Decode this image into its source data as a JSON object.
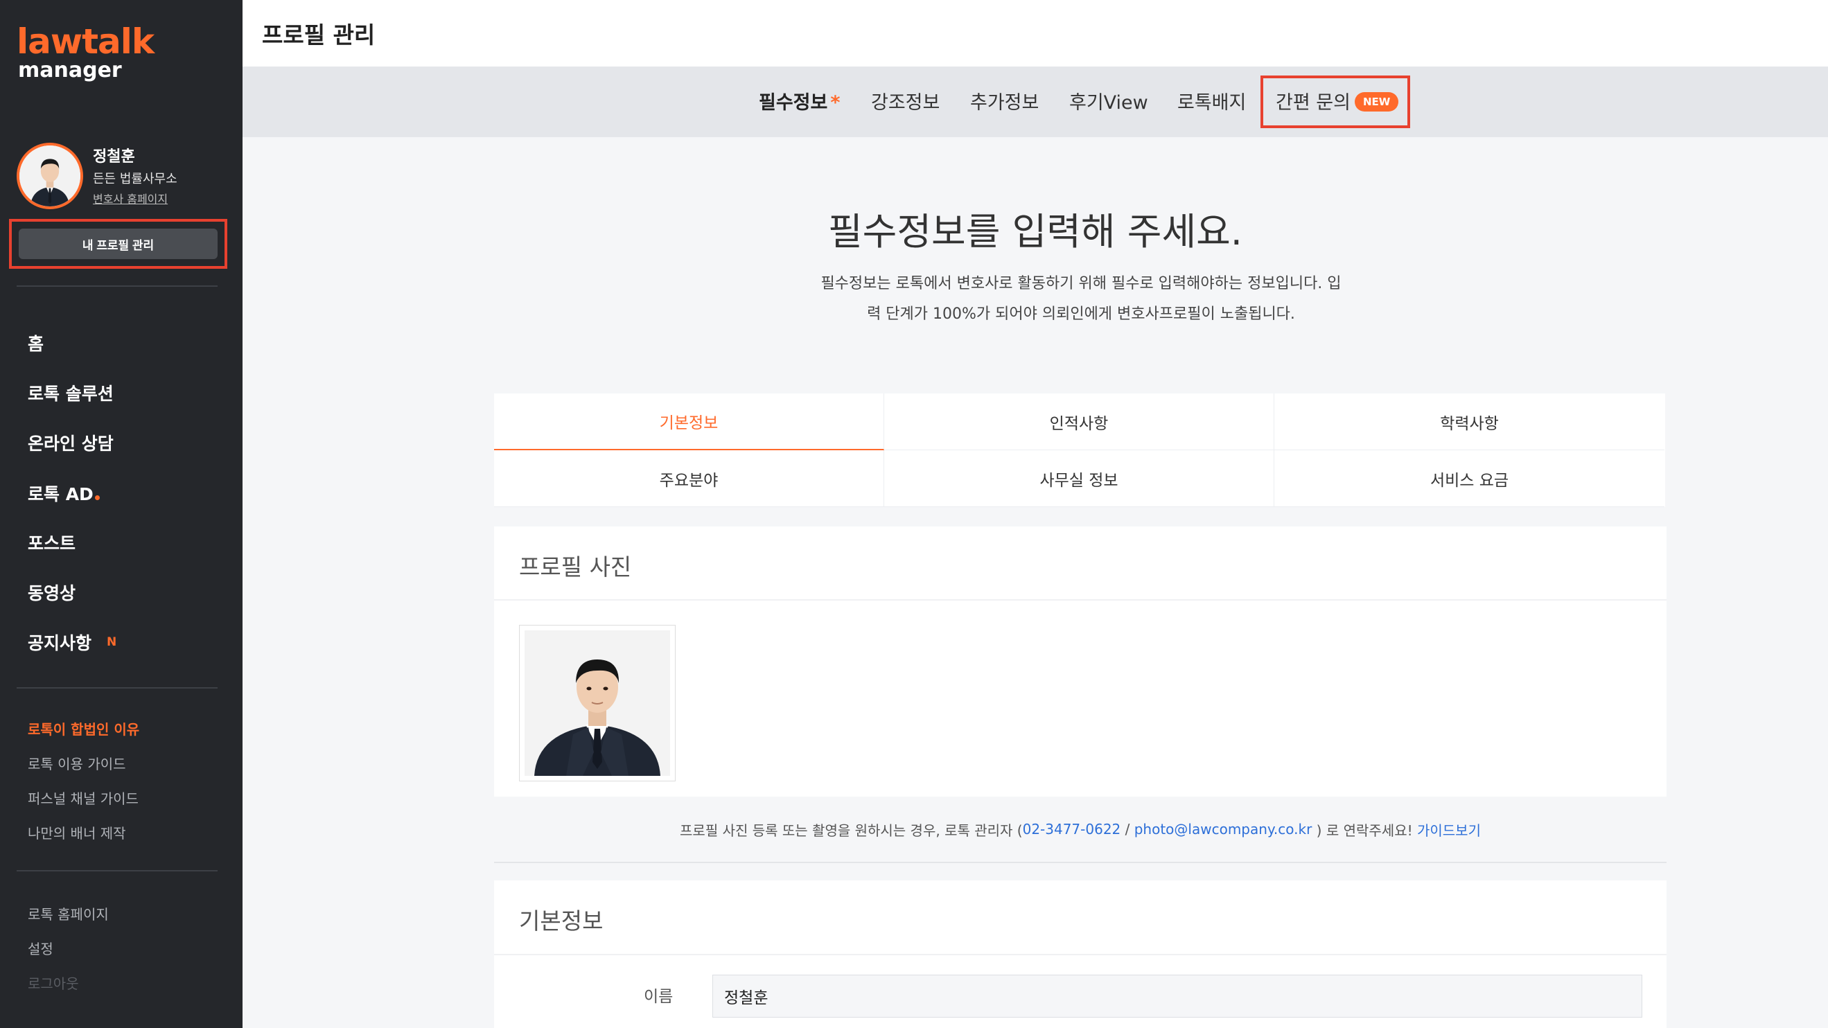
{
  "sidebar": {
    "logo_top": "lawtalk",
    "logo_bottom": "manager",
    "profile": {
      "name": "정철훈",
      "firm": "든든 법률사무소",
      "homepage_link": "변호사 홈페이지",
      "manage_button": "내 프로필 관리"
    },
    "nav": [
      "홈",
      "로톡 솔루션",
      "온라인 상담",
      "로톡 AD",
      "포스트",
      "동영상",
      "공지사항"
    ],
    "nav_new_badge": "N",
    "guides": [
      "로톡이 합법인 이유",
      "로톡 이용 가이드",
      "퍼스널 채널 가이드",
      "나만의 배너 제작"
    ],
    "footer": [
      "로톡 홈페이지",
      "설정",
      "로그아웃"
    ]
  },
  "header": {
    "title": "프로필 관리"
  },
  "tabs": {
    "items": [
      "필수정보",
      "강조정보",
      "추가정보",
      "후기View",
      "로톡배지",
      "간편 문의"
    ],
    "required_mark": "*",
    "new_badge": "NEW"
  },
  "main": {
    "title": "필수정보를 입력해 주세요.",
    "desc_line1": "필수정보는 로톡에서 변호사로 활동하기 위해 필수로 입력해야하는 정보입니다. 입",
    "desc_line2": "력 단계가 100%가 되어야 의뢰인에게 변호사프로필이 노출됩니다."
  },
  "sections": {
    "row1": [
      "기본정보",
      "인적사항",
      "학력사항"
    ],
    "row2": [
      "주요분야",
      "사무실 정보",
      "서비스 요금"
    ]
  },
  "photo_card": {
    "title": "프로필 사진",
    "notice_pre": "프로필 사진 등록 또는 촬영을 원하시는 경우, 로톡 관리자 ( ",
    "phone": "02-3477-0622",
    "slash": " / ",
    "email": "photo@lawcompany.co.kr",
    "notice_post": " ) 로 연락주세요! ",
    "guide_link": "가이드보기"
  },
  "basic_card": {
    "title": "기본정보",
    "name_label": "이름",
    "name_value": "정철훈"
  },
  "colors": {
    "accent": "#ff6a2b",
    "sidebar_bg": "#25272b",
    "highlight_frame": "#e8412f",
    "link": "#2d6fd8"
  }
}
